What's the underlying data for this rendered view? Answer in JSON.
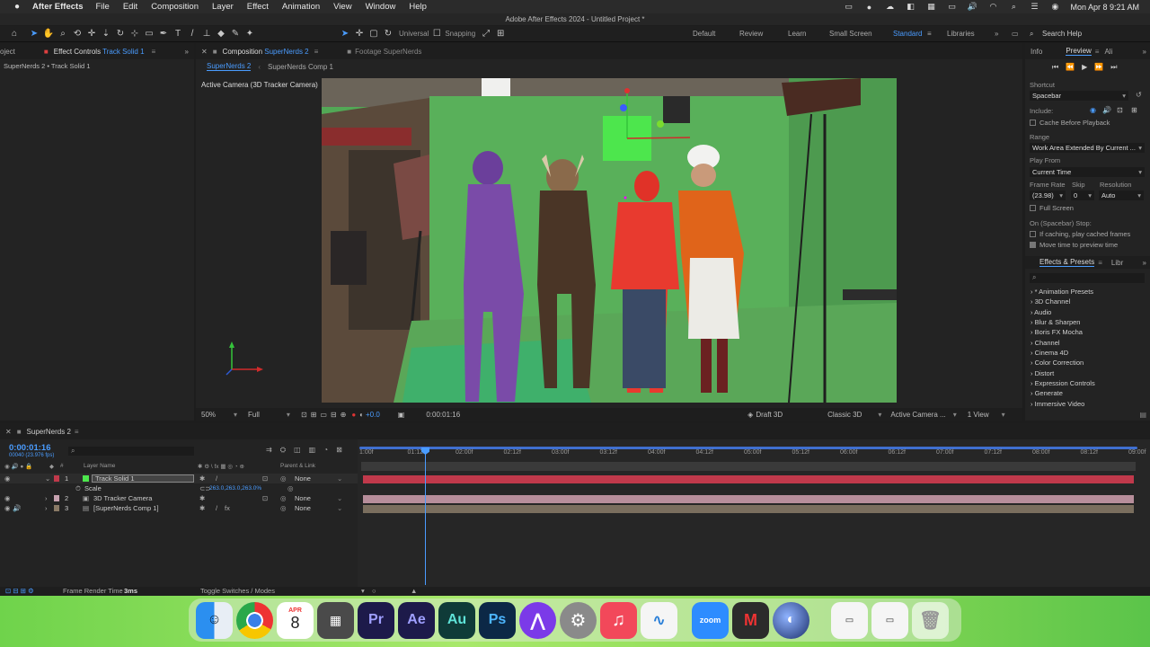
{
  "menubar": {
    "app": "After Effects",
    "items": [
      "File",
      "Edit",
      "Composition",
      "Layer",
      "Effect",
      "Animation",
      "View",
      "Window",
      "Help"
    ],
    "clock": "Mon Apr 8  9:21 AM"
  },
  "window_title": "Adobe After Effects 2024 - Untitled Project *",
  "toolbar": {
    "universal": "Universal",
    "snapping": "Snapping",
    "workspaces": [
      "Default",
      "Review",
      "Learn",
      "Small Screen",
      "Standard",
      "Libraries"
    ],
    "active_workspace": "Standard",
    "search_placeholder": "Search Help"
  },
  "left_panel": {
    "tab_project": "oject",
    "tab_effect_controls": "Effect Controls",
    "tab_effect_controls_target": "Track Solid 1",
    "breadcrumb": "SuperNerds 2 • Track Solid 1"
  },
  "comp_panel": {
    "tab_label": "Composition",
    "tab_comp": "SuperNerds 2",
    "tab_footage": "Footage SuperNerds",
    "subtab_active": "SuperNerds 2",
    "subtab_other": "SuperNerds Comp 1",
    "camera_label": "Active Camera (3D Tracker Camera)",
    "footer": {
      "zoom": "50%",
      "resolution": "Full",
      "exposure": "+0.0",
      "timecode": "0:00:01:16",
      "draft3d": "Draft 3D",
      "renderer": "Classic 3D",
      "view_camera": "Active Camera ...",
      "views": "1 View"
    }
  },
  "right_panel": {
    "tabs": [
      "Info",
      "Preview",
      "Ali"
    ],
    "active_tab": "Preview",
    "shortcut_label": "Shortcut",
    "shortcut_value": "Spacebar",
    "include_label": "Include:",
    "cache_label": "Cache Before Playback",
    "range_label": "Range",
    "range_value": "Work Area Extended By Current ...",
    "play_from_label": "Play From",
    "play_from_value": "Current Time",
    "frame_rate_label": "Frame Rate",
    "skip_label": "Skip",
    "resolution_label": "Resolution",
    "frame_rate_value": "(23.98)",
    "skip_value": "0",
    "resolution_value": "Auto",
    "full_screen_label": "Full Screen",
    "stop_label": "On (Spacebar) Stop:",
    "if_caching_label": "If caching, play cached frames",
    "move_time_label": "Move time to preview time",
    "effects_tab": "Effects & Presets",
    "libraries_tab": "Libr",
    "effects": [
      "* Animation Presets",
      "3D Channel",
      "Audio",
      "Blur & Sharpen",
      "Boris FX Mocha",
      "Channel",
      "Cinema 4D",
      "Color Correction",
      "Distort",
      "Expression Controls",
      "Generate",
      "Immersive Video"
    ]
  },
  "timeline": {
    "tab": "SuperNerds 2",
    "timecode": "0:00:01:16",
    "timecode_sub": "00040 (23.976 fps)",
    "col_layer_name": "Layer Name",
    "col_parent": "Parent & Link",
    "ruler": [
      "1:00f",
      "01:12f",
      "02:00f",
      "02:12f",
      "03:00f",
      "03:12f",
      "04:00f",
      "04:12f",
      "05:00f",
      "05:12f",
      "06:00f",
      "06:12f",
      "07:00f",
      "07:12f",
      "08:00f",
      "08:12f",
      "09:00f"
    ],
    "layers": [
      {
        "num": "1",
        "name": "Track Solid 1",
        "parent": "None",
        "color": "#c0394b"
      },
      {
        "num": "2",
        "name": "3D Tracker Camera",
        "parent": "None",
        "color": "#c7a2b0"
      },
      {
        "num": "3",
        "name": "[SuperNerds Comp 1]",
        "parent": "None",
        "color": "#8a7a66"
      }
    ],
    "scale_label": "Scale",
    "scale_value": "263.0,263.0,263.0%",
    "frame_render_label": "Frame Render Time",
    "frame_render_value": "3ms",
    "toggle_label": "Toggle Switches / Modes"
  },
  "dock": {
    "calendar_month": "APR",
    "calendar_day": "8",
    "apps": [
      "Finder",
      "Chrome",
      "Calendar",
      "Calculator",
      "Premiere Pro",
      "After Effects",
      "Audition",
      "Photoshop",
      "Affinity",
      "System Settings",
      "Music",
      "Freeform",
      "Zoom",
      "Mocha",
      "Cinema 4D",
      "Preview",
      "Screenshot",
      "Trash"
    ]
  },
  "colors": {
    "accent": "#4a9cff",
    "green_screen": "#5fb35c",
    "layer1": "#c0394b"
  }
}
